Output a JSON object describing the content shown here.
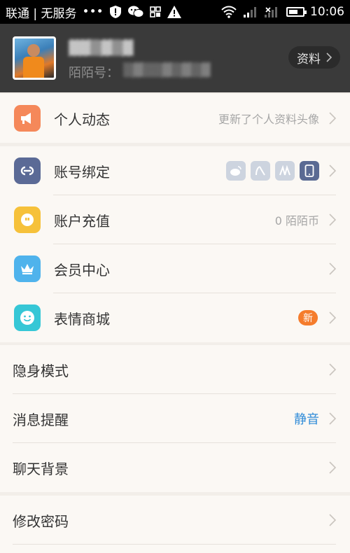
{
  "status_bar": {
    "carrier": "联通 | 无服务",
    "dots": "•••",
    "time": "10:06",
    "battery_level": 0.65
  },
  "profile": {
    "momo_id_label": "陌陌号：",
    "profile_button_label": "资料"
  },
  "sections": [
    {
      "items": [
        {
          "label": "个人动态",
          "value": "更新了个人资料头像",
          "icon": "megaphone-icon",
          "color": "#f5885a"
        }
      ]
    },
    {
      "items": [
        {
          "label": "账号绑定",
          "icon": "link-icon",
          "color": "#5b6a96",
          "bind_icons": [
            "weibo-icon",
            "renren-icon",
            "douban-icon",
            "phone-icon"
          ]
        },
        {
          "label": "账户充值",
          "value": "0 陌陌币",
          "icon": "coin-icon",
          "color": "#f6c13a"
        },
        {
          "label": "会员中心",
          "icon": "crown-icon",
          "color": "#4fb3ec"
        },
        {
          "label": "表情商城",
          "badge": "新",
          "icon": "smiley-icon",
          "color": "#36c7d6"
        }
      ]
    },
    {
      "items": [
        {
          "label": "隐身模式"
        },
        {
          "label": "消息提醒",
          "value": "静音",
          "value_color": "#2f8bd8"
        },
        {
          "label": "聊天背景"
        }
      ]
    },
    {
      "items": [
        {
          "label": "修改密码"
        }
      ]
    }
  ]
}
